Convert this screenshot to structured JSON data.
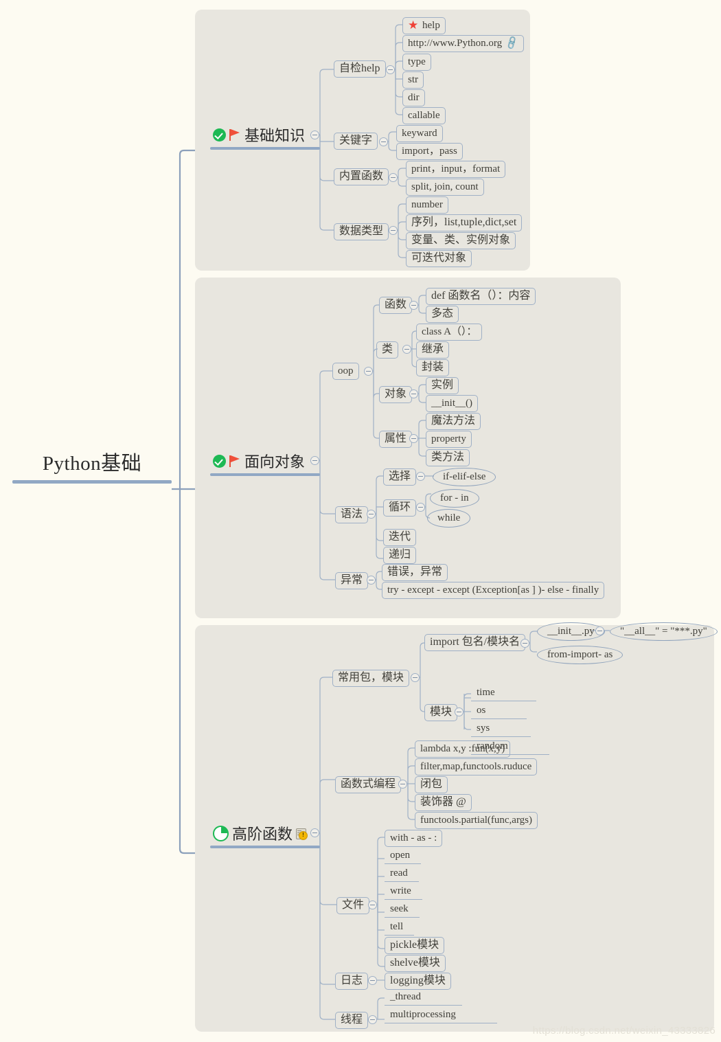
{
  "colors": {
    "page_background": "#fdfbf2",
    "panel_background": "#e8e6df",
    "node_border": "#9fb0c6",
    "trunk_line": "#91a8c4",
    "text": "#41403a",
    "accent_green": "#1db954",
    "accent_red": "#ef4136",
    "accent_link": "#4a7fd4",
    "accent_warning": "#f2b705"
  },
  "root": {
    "label": "Python基础",
    "style": "underline"
  },
  "watermark": "https://blog.csdn.net/weixin_43333826",
  "branches": [
    {
      "id": "basics",
      "label": "基础知识",
      "icons": [
        "check-circle-icon",
        "flag-icon"
      ],
      "children": [
        {
          "label": "自检help",
          "children": [
            {
              "label": "help",
              "icon": "star-icon"
            },
            {
              "label": "http://www.Python.org",
              "icon": "link-icon"
            },
            {
              "label": "type"
            },
            {
              "label": "str"
            },
            {
              "label": "dir"
            },
            {
              "label": "callable"
            }
          ]
        },
        {
          "label": "关键字",
          "children": [
            {
              "label": "keyward"
            },
            {
              "label": "import，pass"
            }
          ]
        },
        {
          "label": "内置函数",
          "children": [
            {
              "label": "print，input，format"
            },
            {
              "label": "split, join, count"
            }
          ]
        },
        {
          "label": "数据类型",
          "children": [
            {
              "label": "number"
            },
            {
              "label": "序列，list,tuple,dict,set"
            },
            {
              "label": "变量、类、实例对象"
            },
            {
              "label": "可迭代对象"
            }
          ]
        }
      ]
    },
    {
      "id": "oop",
      "label": "面向对象",
      "icons": [
        "check-circle-icon",
        "flag-icon"
      ],
      "children": [
        {
          "label": "oop",
          "children": [
            {
              "label": "函数",
              "children": [
                {
                  "label": "def 函数名（）：内容"
                },
                {
                  "label": "多态"
                }
              ]
            },
            {
              "label": "类",
              "children": [
                {
                  "label": "class A（）："
                },
                {
                  "label": "继承"
                },
                {
                  "label": "封装"
                }
              ]
            },
            {
              "label": "对象",
              "children": [
                {
                  "label": "实例"
                },
                {
                  "label": "__init__()"
                }
              ]
            },
            {
              "label": "属性",
              "children": [
                {
                  "label": "魔法方法"
                },
                {
                  "label": "property"
                },
                {
                  "label": "类方法"
                }
              ]
            }
          ]
        },
        {
          "label": "语法",
          "children": [
            {
              "label": "选择",
              "children": [
                {
                  "label": "if-elif-else",
                  "shape": "ellipse"
                }
              ]
            },
            {
              "label": "循环",
              "children": [
                {
                  "label": "for - in",
                  "shape": "ellipse"
                },
                {
                  "label": "while",
                  "shape": "ellipse"
                }
              ]
            },
            {
              "label": "迭代"
            },
            {
              "label": "递归"
            }
          ]
        },
        {
          "label": "异常",
          "children": [
            {
              "label": "错误，异常"
            },
            {
              "label": "try - except - except (Exception[as ] )- else -  finally"
            }
          ]
        }
      ]
    },
    {
      "id": "advanced",
      "label": "高阶函数",
      "icons": [
        "pie-progress-icon",
        "note-warning-icon"
      ],
      "children": [
        {
          "label": "常用包，模块",
          "children": [
            {
              "label": "import 包名/模块名",
              "children": [
                {
                  "label": "__init__.py",
                  "shape": "ellipse",
                  "children": [
                    {
                      "label": "\"__all__\" = \"***.py\"",
                      "shape": "ellipse"
                    }
                  ]
                },
                {
                  "label": "from-import- as",
                  "shape": "ellipse"
                }
              ]
            },
            {
              "label": "模块",
              "children": [
                {
                  "label": "time",
                  "shape": "underline"
                },
                {
                  "label": "os",
                  "shape": "underline"
                },
                {
                  "label": "sys",
                  "shape": "underline"
                },
                {
                  "label": "random",
                  "shape": "underline"
                }
              ]
            }
          ]
        },
        {
          "label": "函数式编程",
          "children": [
            {
              "label": "lambda x,y :fun(x,y)"
            },
            {
              "label": "filter,map,functools.ruduce"
            },
            {
              "label": "闭包"
            },
            {
              "label": "装饰器 @"
            },
            {
              "label": "functools.partial(func,args)"
            }
          ]
        },
        {
          "label": "文件",
          "children": [
            {
              "label": "with -  as - :"
            },
            {
              "label": "open",
              "shape": "underline"
            },
            {
              "label": "read",
              "shape": "underline"
            },
            {
              "label": "write",
              "shape": "underline"
            },
            {
              "label": "seek",
              "shape": "underline"
            },
            {
              "label": "tell",
              "shape": "underline"
            },
            {
              "label": "pickle模块"
            },
            {
              "label": "shelve模块"
            }
          ]
        },
        {
          "label": "日志",
          "children": [
            {
              "label": "logging模块"
            }
          ]
        },
        {
          "label": "线程",
          "children": [
            {
              "label": "_thread",
              "shape": "underline"
            },
            {
              "label": "multiprocessing",
              "shape": "underline"
            }
          ]
        }
      ]
    }
  ]
}
